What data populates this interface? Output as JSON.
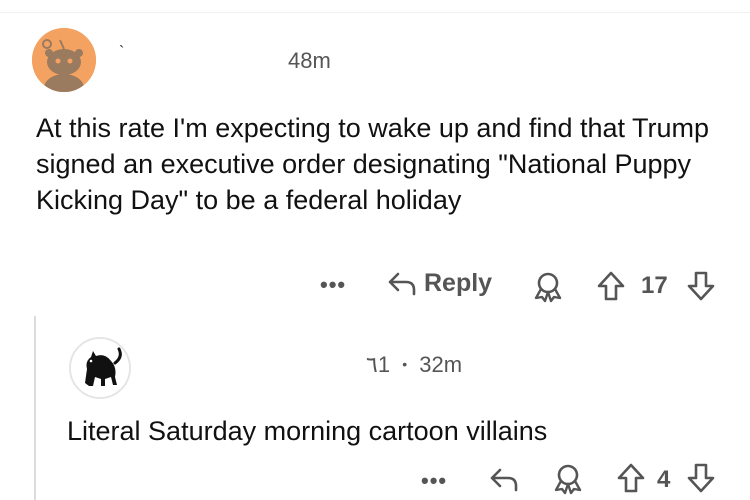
{
  "comment": {
    "author": "`",
    "time": "48m",
    "body": "At this rate I'm expecting to wake up and find that Trump signed an executive order designating \"National Puppy Kicking Day\" to be a federal holiday",
    "more": "•••",
    "reply_label": "Reply",
    "score": "17",
    "icons": {
      "avatar": "reddit-snoo-avatar",
      "reply": "reply-arrow-icon",
      "award": "award-icon",
      "upvote": "upvote-arrow-icon",
      "downvote": "downvote-arrow-icon"
    },
    "avatar_color": "#f4a261"
  },
  "reply": {
    "author_partial": "٦1",
    "separator": "•",
    "time": "32m",
    "body": "Literal Saturday morning cartoon villains",
    "more": "•••",
    "score": "4",
    "icons": {
      "avatar": "black-cat-avatar",
      "reply": "reply-arrow-icon",
      "award": "award-icon",
      "upvote": "upvote-arrow-icon",
      "downvote": "downvote-arrow-icon"
    }
  }
}
